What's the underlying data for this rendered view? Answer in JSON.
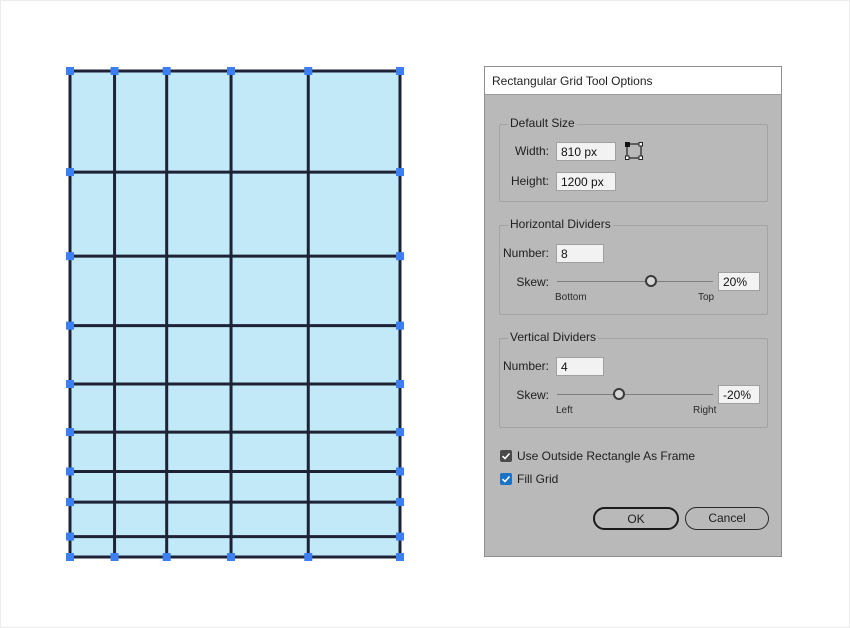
{
  "grid_art": {
    "fill_color": "#c2e9f8",
    "stroke_color": "#1e2236",
    "handle_color": "#3b7ff2"
  },
  "dialog": {
    "title": "Rectangular Grid Tool Options",
    "default_size": {
      "title": "Default Size",
      "width_label": "Width:",
      "width_value": "810 px",
      "height_label": "Height:",
      "height_value": "1200 px"
    },
    "horizontal_dividers": {
      "title": "Horizontal Dividers",
      "number_label": "Number:",
      "number_value": "8",
      "skew_label": "Skew:",
      "skew_value": "20%",
      "skew_fraction": 0.6,
      "min_label": "Bottom",
      "max_label": "Top"
    },
    "vertical_dividers": {
      "title": "Vertical Dividers",
      "number_label": "Number:",
      "number_value": "4",
      "skew_label": "Skew:",
      "skew_value": "-20%",
      "skew_fraction": 0.4,
      "min_label": "Left",
      "max_label": "Right"
    },
    "use_outside_rectangle": {
      "label": "Use Outside Rectangle As Frame",
      "checked": true
    },
    "fill_grid": {
      "label": "Fill Grid",
      "checked": true
    },
    "ok_label": "OK",
    "cancel_label": "Cancel",
    "colors": {
      "checkbox_gray": "#4a4a4a",
      "checkbox_blue": "#1a73c8"
    }
  }
}
